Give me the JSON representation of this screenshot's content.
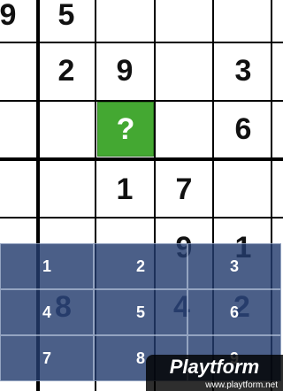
{
  "grid_visible": {
    "r0": [
      "9",
      "5",
      "",
      "",
      ""
    ],
    "r1": [
      "",
      "2",
      "9",
      "",
      "3"
    ],
    "r2": [
      "",
      "",
      "?",
      "",
      "6"
    ],
    "r3": [
      "",
      "",
      "1",
      "7",
      ""
    ],
    "r4": [
      "",
      "",
      "",
      "9",
      "1"
    ]
  },
  "selected_cell_label": "?",
  "keypad": [
    "1",
    "2",
    "3",
    "4",
    "5",
    "6",
    "7",
    "8",
    "9"
  ],
  "keypad_behind_digits": [
    "8",
    "4",
    "2"
  ],
  "watermark": {
    "brand": "Playtform",
    "url": "www.playtform.net"
  },
  "colors": {
    "selected_green": "#44a832",
    "keypad_blue": "#233c6e"
  }
}
